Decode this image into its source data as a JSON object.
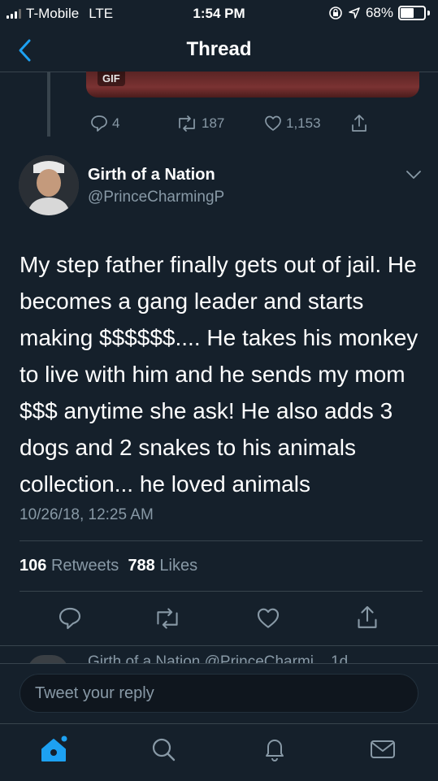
{
  "status_bar": {
    "carrier": "T-Mobile",
    "network": "LTE",
    "time": "1:54 PM",
    "battery_percent": "68%",
    "battery_level": 0.68
  },
  "nav": {
    "title": "Thread",
    "back_icon": "chevron-left-icon"
  },
  "previous_tweet": {
    "media_badge": "GIF",
    "replies": "4",
    "retweets": "187",
    "likes": "1,153"
  },
  "tweet": {
    "author_name": "Girth of a Nation",
    "author_handle": "@PrinceCharmingP",
    "text": "My step father finally gets out of jail. He becomes a gang leader and starts making $$$$$$.... He takes his monkey to live with him and he sends my mom $$$ anytime she ask! He also adds 3 dogs and 2 snakes to his animals collection... he loved animals",
    "timestamp": "10/26/18, 12:25 AM",
    "retweet_count": "106",
    "retweet_label": "Retweets",
    "like_count": "788",
    "like_label": "Likes"
  },
  "next_tweet_preview": {
    "text": "Girth of a Nation @PrinceCharmi... 1d"
  },
  "reply": {
    "placeholder": "Tweet your reply"
  },
  "tabbar": {
    "items": [
      "home-icon",
      "search-icon",
      "notifications-icon",
      "messages-icon"
    ],
    "active": "home-icon",
    "accent": "#1da1f2"
  },
  "colors": {
    "background": "#15202b",
    "secondary_text": "#8899a6",
    "divider": "#38444d",
    "accent": "#1da1f2"
  }
}
